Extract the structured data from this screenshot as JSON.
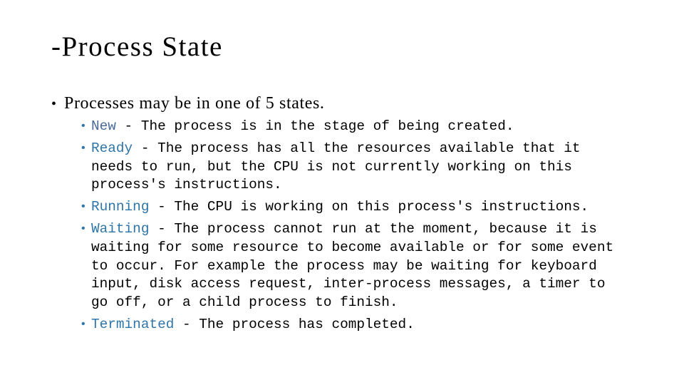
{
  "slide": {
    "title": "-Process State",
    "intro_bullet": "Processes may be in one of 5 states.",
    "states": [
      {
        "term": "New",
        "description_lines": [
          " - The process is in the stage of being created."
        ]
      },
      {
        "term": "Ready",
        "description_lines": [
          " - The process has all the resources available that it",
          "needs to run, but the CPU is not currently working on this",
          "process's instructions."
        ]
      },
      {
        "term": "Running",
        "description_lines": [
          " - The CPU is working on this process's instructions."
        ]
      },
      {
        "term": "Waiting",
        "description_lines": [
          " - The process cannot run at the moment, because it is",
          "waiting for some resource to become available or for some event",
          "to occur. For example the process may be waiting for keyboard",
          "input, disk access request, inter-process messages, a timer to",
          "go off, or a child process to finish."
        ]
      },
      {
        "term": "Terminated",
        "description_lines": [
          " - The process has completed."
        ]
      }
    ],
    "colors": {
      "term_accent": "#2e75a8",
      "term_new": "#4a6a9a",
      "text": "#000000",
      "background": "#ffffff"
    },
    "bullet_glyph": "•"
  }
}
